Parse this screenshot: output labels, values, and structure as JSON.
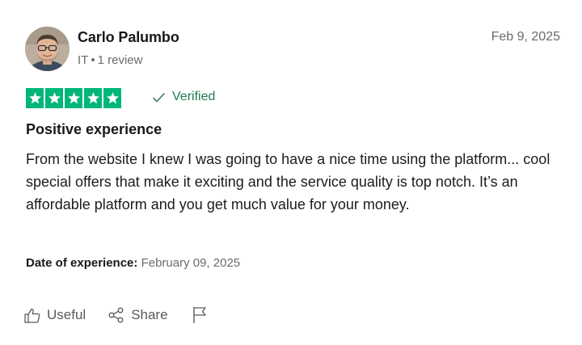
{
  "reviewer": {
    "name": "Carlo Palumbo",
    "country": "IT",
    "separator": "•",
    "review_count": "1 review",
    "avatar": "avatar-photo"
  },
  "review": {
    "date": "Feb 9, 2025",
    "rating": 5,
    "rating_max": 5,
    "verified_label": "Verified",
    "title": "Positive experience",
    "body": "From the website I knew I was going to have a nice time using the platform... cool special offers that make it exciting and the service quality is top notch. It’s an affordable platform and you get much value for your money.",
    "experience_label": "Date of experience:",
    "experience_date": "February 09, 2025"
  },
  "actions": {
    "useful_label": "Useful",
    "share_label": "Share",
    "useful_icon": "thumbs-up-icon",
    "share_icon": "share-icon",
    "flag_icon": "flag-icon"
  },
  "colors": {
    "star_green": "#00b67a",
    "verified_green": "#1f7a4f",
    "muted_text": "#6b6b6b"
  }
}
